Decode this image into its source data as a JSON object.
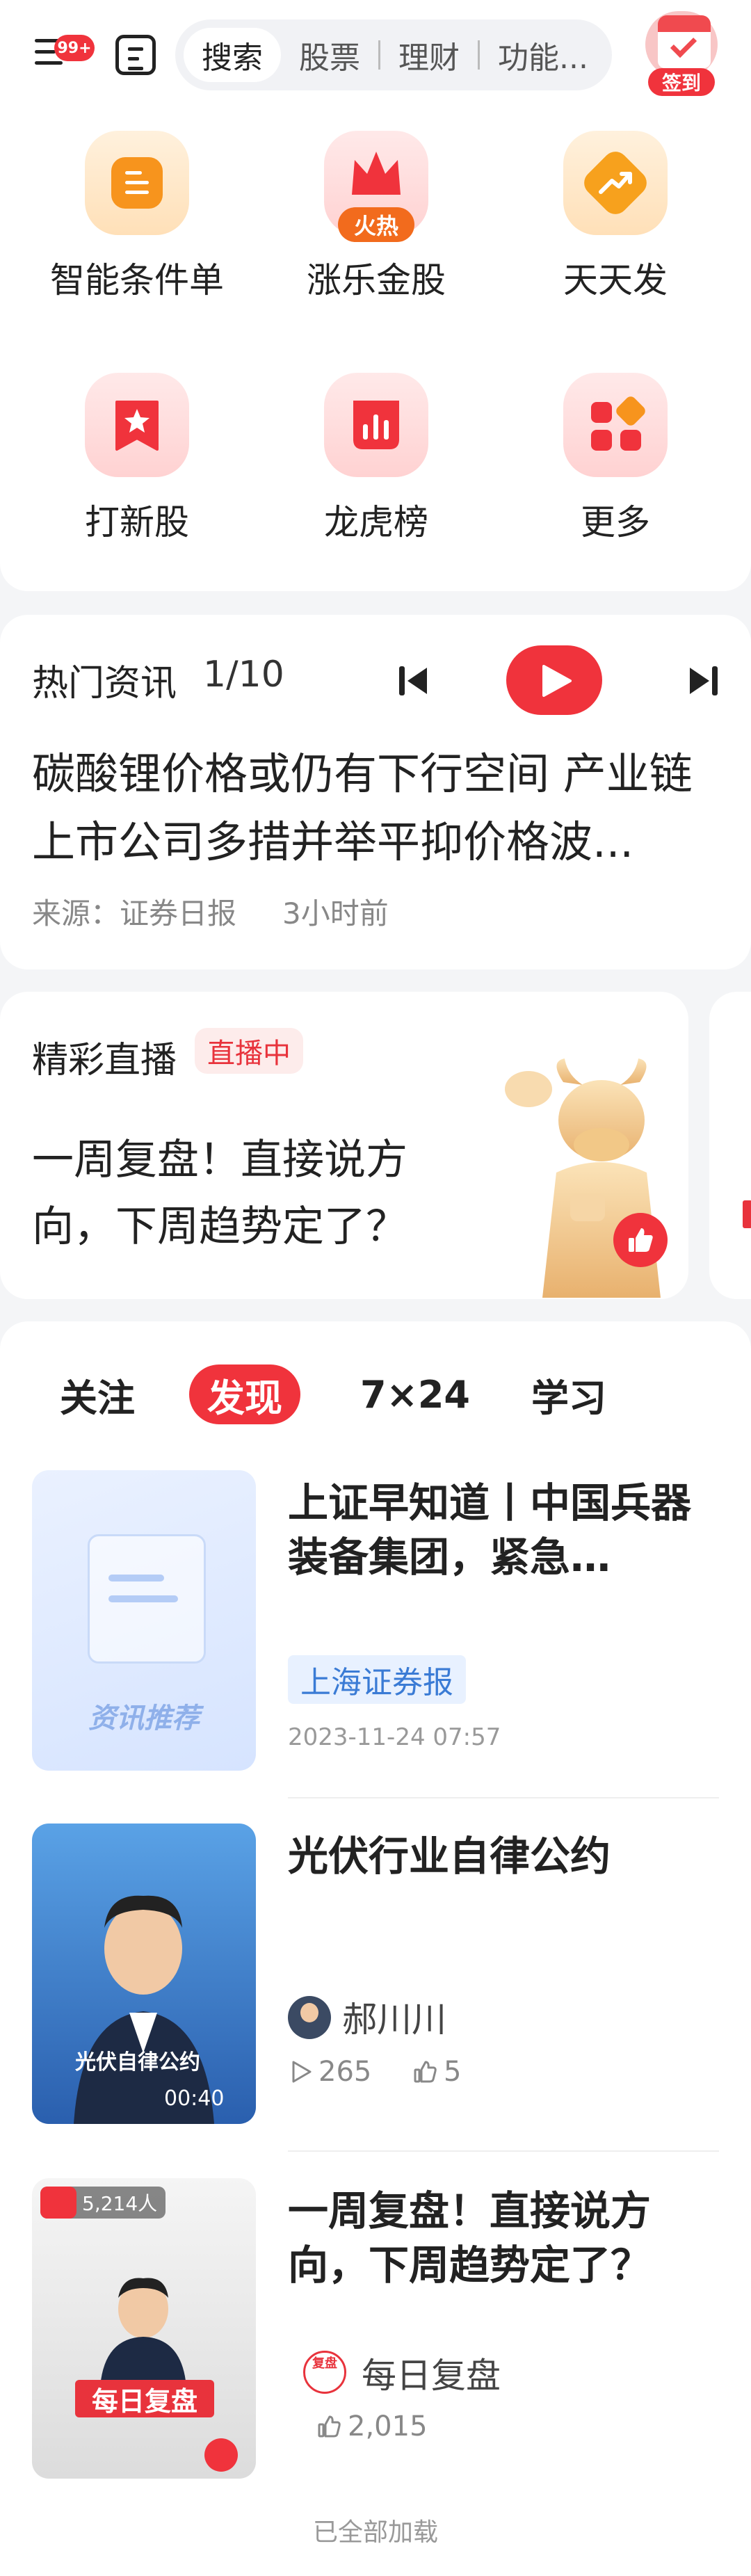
{
  "topbar": {
    "badge": "99+",
    "search_tabs": [
      "搜索",
      "股票",
      "理财",
      "功能..."
    ],
    "signin_label": "签到"
  },
  "grid": {
    "items": [
      {
        "label": "智能条件单",
        "icon": "smart-order-icon"
      },
      {
        "label": "涨乐金股",
        "icon": "fire-crown-icon",
        "badge": "火热"
      },
      {
        "label": "天天发",
        "icon": "trend-up-icon"
      },
      {
        "label": "打新股",
        "icon": "star-bookmark-icon"
      },
      {
        "label": "龙虎榜",
        "icon": "bar-chart-icon"
      },
      {
        "label": "更多",
        "icon": "more-apps-icon"
      }
    ]
  },
  "news": {
    "title": "热门资讯",
    "counter": "1/10",
    "headline": "碳酸锂价格或仍有下行空间 产业链上市公司多措并举平抑价格波...",
    "source": "来源：证券日报",
    "time": "3小时前"
  },
  "live": {
    "title": "精彩直播",
    "tag": "直播中",
    "text": "一周复盘！直接说方向，下周趋势定了？"
  },
  "feed": {
    "tabs": [
      "关注",
      "发现",
      "7×24",
      "学习"
    ],
    "active_tab": "发现",
    "items": [
      {
        "title": "上证早知道丨中国兵器装备集团，紧急…",
        "thumb_text": "资讯推荐",
        "source": "上海证券报",
        "date": "2023-11-24 07:57"
      },
      {
        "title": "光伏行业自律公约",
        "thumb_caption": "光伏自律公约",
        "duration": "00:40",
        "author": "郝川川",
        "views": "265",
        "likes": "5"
      },
      {
        "title": "一周复盘！直接说方向，下周趋势定了？",
        "live_viewers": "5,214人",
        "thumb_headline": "每日复盘",
        "author": "每日复盘",
        "author_logo": "复盘",
        "likes": "2,015"
      }
    ],
    "footer": "已全部加载"
  },
  "colors": {
    "accent": "#f0333c",
    "orange": "#f7941d",
    "tag_blue": "#3a7bd5"
  }
}
